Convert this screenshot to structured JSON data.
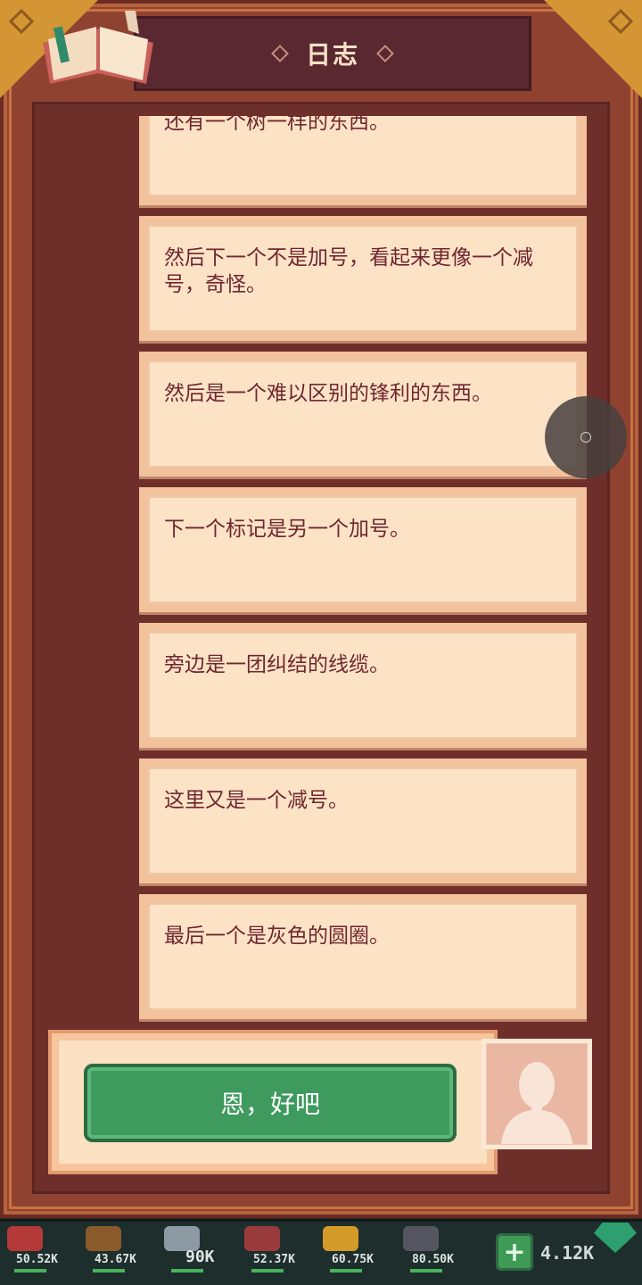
{
  "header": {
    "title": "日志"
  },
  "log_entries": [
    {
      "text": "还有一个树一样的东西。"
    },
    {
      "text": "然后下一个不是加号，看起来更像一个减号，奇怪。"
    },
    {
      "text": "然后是一个难以区别的锋利的东西。"
    },
    {
      "text": "下一个标记是另一个加号。"
    },
    {
      "text": "旁边是一团纠结的线缆。"
    },
    {
      "text": "这里又是一个减号。"
    },
    {
      "text": "最后一个是灰色的圆圈。"
    }
  ],
  "dialog": {
    "button_label": "恩，好吧"
  },
  "resources": [
    {
      "icon": "meat-icon",
      "value": "50.52K",
      "color": "#b43a3a"
    },
    {
      "icon": "wood-log-icon",
      "value": "43.67K",
      "color": "#8a5a2b"
    },
    {
      "icon": "stone-icon",
      "value": "90K",
      "color": "#8e9aa3"
    },
    {
      "icon": "rope-icon",
      "value": "52.37K",
      "color": "#9a3b3b"
    },
    {
      "icon": "gold-icon",
      "value": "60.75K",
      "color": "#d49a28"
    },
    {
      "icon": "ore-icon",
      "value": "80.50K",
      "color": "#55555f"
    }
  ],
  "gems": {
    "value": "4.12K",
    "color": "#2e9f6f"
  }
}
